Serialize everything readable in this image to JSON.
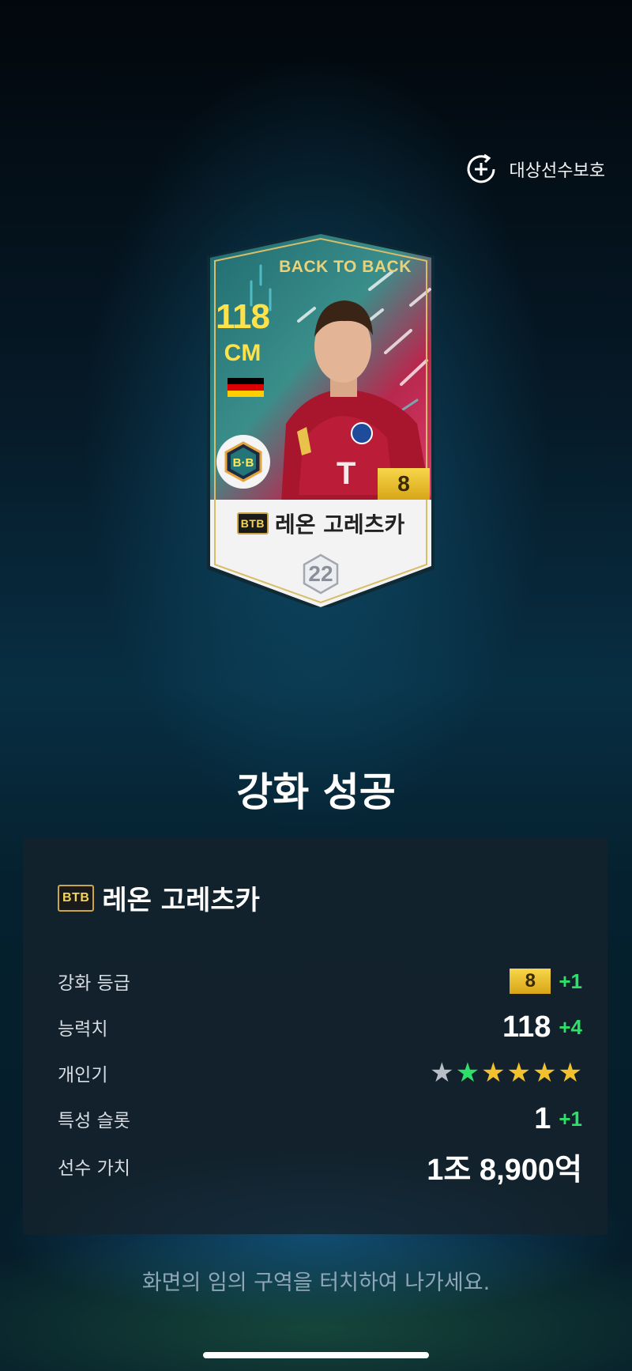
{
  "protect": {
    "label": "대상선수보호",
    "icon": "add-protect-icon"
  },
  "card": {
    "season": "BACK TO BACK",
    "ovr": "118",
    "position": "CM",
    "nation_flag": [
      "#000000",
      "#dd0000",
      "#ffce00"
    ],
    "club_badge": "B·B",
    "grade": "8",
    "season_tag": "BTB",
    "name": "레온 고레츠카",
    "level": "22"
  },
  "result_title": "강화 성공",
  "panel": {
    "season_tag": "BTB",
    "name": "레온 고레츠카",
    "rows": {
      "grade": {
        "label": "강화 등급",
        "value": "8",
        "delta": "+1"
      },
      "ability": {
        "label": "능력치",
        "value": "118",
        "delta": "+4"
      },
      "skill": {
        "label": "개인기",
        "stars_total": 6,
        "stars_gray": 1,
        "stars_green": 1,
        "stars_gold": 4
      },
      "trait": {
        "label": "특성 슬롯",
        "value": "1",
        "delta": "+1"
      },
      "price": {
        "label": "선수 가치",
        "value": "1조 8,900억"
      }
    }
  },
  "hint": "화면의 임의 구역을 터치하여 나가세요.",
  "colors": {
    "accent_green": "#2ee06a",
    "grade_gold": "#f2c12e"
  }
}
